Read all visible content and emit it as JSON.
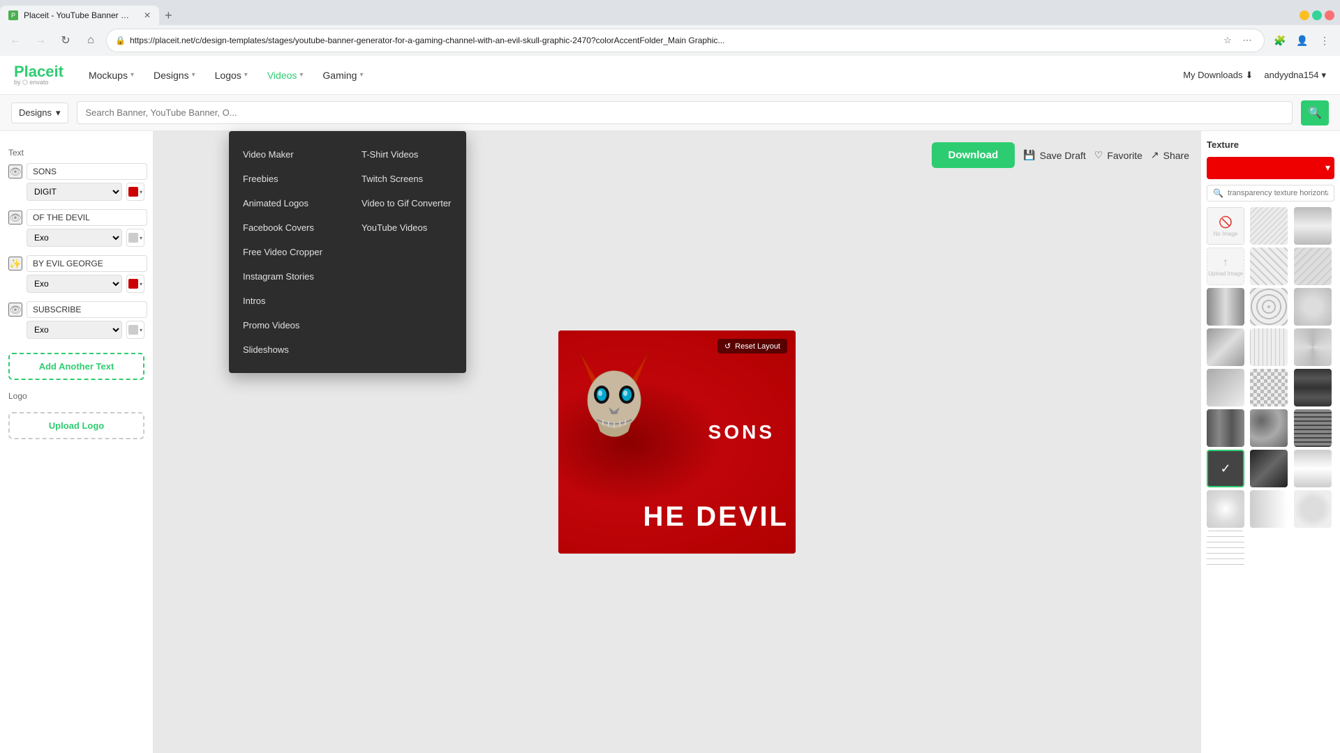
{
  "browser": {
    "tab_title": "Placeit - YouTube Banner Gene...",
    "url": "https://placeit.net/c/design-templates/stages/youtube-banner-generator-for-a-gaming-channel-with-an-evil-skull-graphic-2470?colorAccentFolder_Main Graphic...",
    "new_tab_label": "+",
    "back_disabled": false,
    "forward_disabled": true
  },
  "header": {
    "logo_main": "Placeit",
    "logo_sub": "by ⬡ envato",
    "nav_items": [
      {
        "label": "Mockups",
        "id": "mockups"
      },
      {
        "label": "Designs",
        "id": "designs"
      },
      {
        "label": "Logos",
        "id": "logos"
      },
      {
        "label": "Videos",
        "id": "videos"
      },
      {
        "label": "Gaming",
        "id": "gaming"
      }
    ],
    "my_downloads": "My Downloads",
    "user_name": "andyydna154"
  },
  "search": {
    "dropdown_label": "Designs",
    "placeholder": "Search Banner, YouTube Banner, O...",
    "button_icon": "🔍"
  },
  "left_panel": {
    "text_label": "Text",
    "text_items": [
      {
        "id": "text-1",
        "value": "SONS",
        "font": "DIGIT",
        "color": "#cc0000",
        "visible": true
      },
      {
        "id": "text-2",
        "value": "OF THE DEVIL",
        "font": "Exo",
        "color": "#cccccc",
        "visible": true
      },
      {
        "id": "text-3",
        "value": "BY EVIL GEORGE",
        "font": "Exo",
        "color": "#cc0000",
        "visible": true,
        "sparkle": true
      },
      {
        "id": "text-4",
        "value": "SUBSCRIBE",
        "font": "Exo",
        "color": "#cccccc",
        "visible": true
      }
    ],
    "add_text_label": "Add Another Text",
    "logo_label": "Logo",
    "upload_logo_label": "Upload Logo"
  },
  "canvas": {
    "reset_layout": "↺ Reset Layout",
    "banner_text_sons": "SONS",
    "banner_text_devil": "HE DEVIL"
  },
  "toolbar": {
    "download_label": "Download",
    "save_draft_label": "Save Draft",
    "favorite_label": "Favorite",
    "share_label": "Share"
  },
  "texture_panel": {
    "label": "Texture",
    "search_placeholder": "transparency texture horizonta",
    "color_bar": "#ee0000"
  },
  "videos_dropdown": {
    "items_left": [
      "Video Maker",
      "Freebies",
      "Animated Logos",
      "Facebook Covers",
      "Free Video Cropper",
      "Instagram Stories",
      "Intros",
      "Promo Videos",
      "Slideshows"
    ],
    "items_right": [
      "T-Shirt Videos",
      "Twitch Screens",
      "Video to Gif Converter",
      "YouTube Videos"
    ]
  }
}
